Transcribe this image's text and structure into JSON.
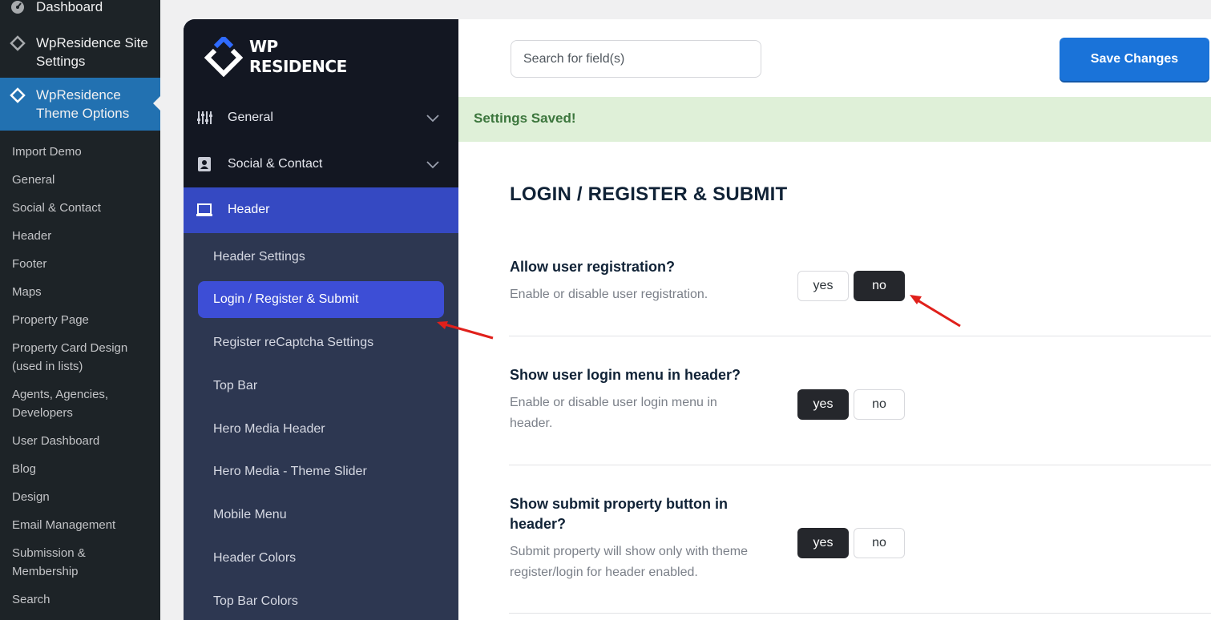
{
  "wp_sidebar": {
    "top_items": [
      {
        "label": "Dashboard",
        "icon": "dashboard-icon"
      },
      {
        "label": "WpResidence Site Settings",
        "icon": "diamond-icon"
      },
      {
        "label": "WpResidence Theme Options",
        "icon": "diamond-icon"
      }
    ],
    "submenu": [
      "Import Demo",
      "General",
      "Social & Contact",
      "Header",
      "Footer",
      "Maps",
      "Property Page",
      "Property Card Design (used in lists)",
      "Agents, Agencies, Developers",
      "User Dashboard",
      "Blog",
      "Design",
      "Email Management",
      "Submission & Membership",
      "Search"
    ]
  },
  "brand": {
    "line1": "WP",
    "line2": "RESIDENCE",
    "accent": "#2f6bff"
  },
  "theme_nav": {
    "sections": [
      {
        "label": "General",
        "icon": "sliders-icon"
      },
      {
        "label": "Social & Contact",
        "icon": "contact-card-icon"
      },
      {
        "label": "Header",
        "icon": "monitor-icon"
      }
    ],
    "header_items": [
      "Header Settings",
      "Login / Register & Submit",
      "Register reCaptcha Settings",
      "Top Bar",
      "Hero Media Header",
      "Hero Media - Theme Slider",
      "Mobile Menu",
      "Header Colors",
      "Top Bar Colors"
    ],
    "active_item": "Login / Register & Submit"
  },
  "toolbar": {
    "search_placeholder": "Search for field(s)",
    "save_label": "Save Changes"
  },
  "notice": {
    "text": "Settings Saved!"
  },
  "section": {
    "title": "LOGIN / REGISTER & SUBMIT"
  },
  "options": [
    {
      "title": "Allow user registration?",
      "desc": "Enable or disable user registration.",
      "yes": "yes",
      "no": "no",
      "selected": "no"
    },
    {
      "title": "Show user login menu in header?",
      "desc": "Enable or disable user login menu in header.",
      "yes": "yes",
      "no": "no",
      "selected": "yes"
    },
    {
      "title": "Show submit property button in header?",
      "desc": "Submit property will show only with theme register/login for header enabled.",
      "yes": "yes",
      "no": "no",
      "selected": "yes"
    }
  ],
  "colors": {
    "wp_sidebar": "#1d2327",
    "wp_active": "#2271b1",
    "nav_dark": "#131722",
    "nav": "#2d3751",
    "nav_active": "#3549c2",
    "save": "#1a73d9",
    "notice_bg": "#dff0d8",
    "arrow": "#e0201b"
  }
}
